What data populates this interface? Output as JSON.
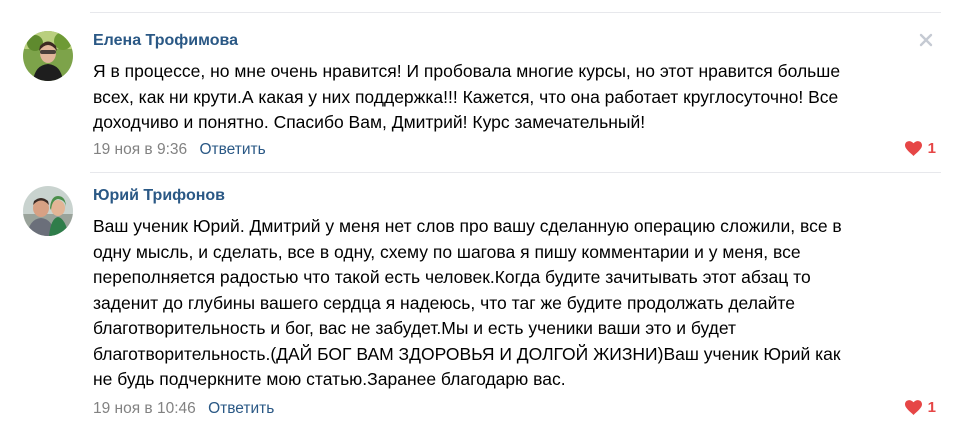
{
  "comments": [
    {
      "author": "Елена Трофимова",
      "text": "Я в процессе, но мне очень нравится! И пробовала многие курсы, но этот нравится больше\nвсех, как ни крути.А какая у них поддержка!!! Кажется, что она работает круглосуточно! Все\nдоходчиво и понятно. Спасибо Вам, Дмитрий! Курс замечательный!",
      "date": "19 ноя в 9:36",
      "reply_label": "Ответить",
      "likes": "1",
      "avatar_icon": "user-avatar-icon"
    },
    {
      "author": "Юрий Трифонов",
      "text": "Ваш ученик Юрий. Дмитрий у меня нет слов про вашу сделанную операцию сложили, все в\nодну мысль, и сделать, все в одну, схему по шагова я пишу комментарии и у меня, все\nпереполняется радостью что такой есть человек.Когда будите зачитывать этот абзац то\nзаденит до глубины вашего сердца я надеюсь, что таг же будите продолжать делайте\nблаготворительность и бог, вас не забудет.Мы и есть ученики ваши это и будет\nблаготворительность.(ДАЙ БОГ ВАМ ЗДОРОВЬЯ И ДОЛГОЙ ЖИЗНИ)Ваш ученик Юрий как\nне будь подчеркните мою статью.Заранее благодарю вас.",
      "date": "19 ноя в 10:46",
      "reply_label": "Ответить",
      "likes": "1",
      "avatar_icon": "user-avatar-icon"
    }
  ],
  "colors": {
    "author": "#2a5885",
    "meta": "#828282",
    "like": "#e64646",
    "divider": "#e7e8ec"
  },
  "icons": {
    "close": "close-icon",
    "like": "heart-icon"
  }
}
